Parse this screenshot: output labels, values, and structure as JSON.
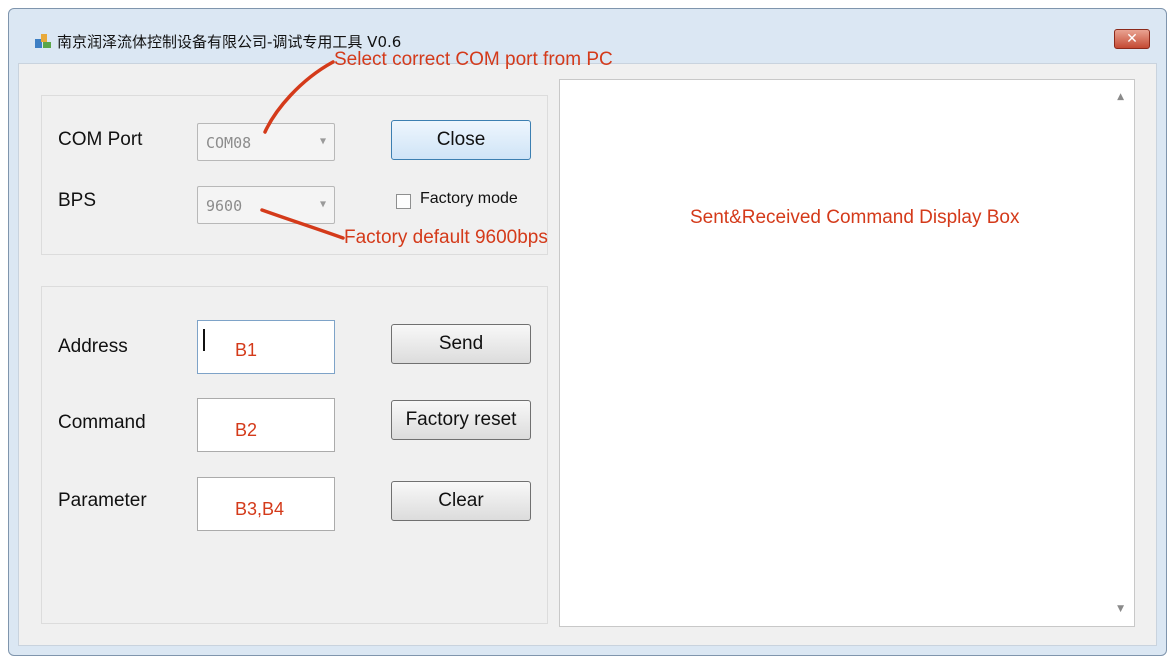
{
  "window": {
    "title": "南京润泽流体控制设备有限公司-调试专用工具 V0.6",
    "close_glyph": "✕",
    "app_icon": "app-icon"
  },
  "connection": {
    "com_port_label": "COM Port",
    "com_port_value": "COM08",
    "bps_label": "BPS",
    "bps_value": "9600",
    "close_button": "Close",
    "factory_mode_label": "Factory mode",
    "factory_mode_checked": false
  },
  "command": {
    "address_label": "Address",
    "command_label": "Command",
    "parameter_label": "Parameter",
    "send_button": "Send",
    "factory_reset_button": "Factory reset",
    "clear_button": "Clear"
  },
  "annotations": {
    "com_port_note": "Select correct COM port from PC",
    "bps_note": "Factory default 9600bps",
    "display_note": "Sent&Received Command Display Box",
    "address_note": "B1",
    "command_note": "B2",
    "parameter_note": "B3,B4"
  },
  "colors": {
    "annotation": "#d43a1a",
    "window_frame": "#dbe7f3",
    "close_button": "#c44a33"
  }
}
